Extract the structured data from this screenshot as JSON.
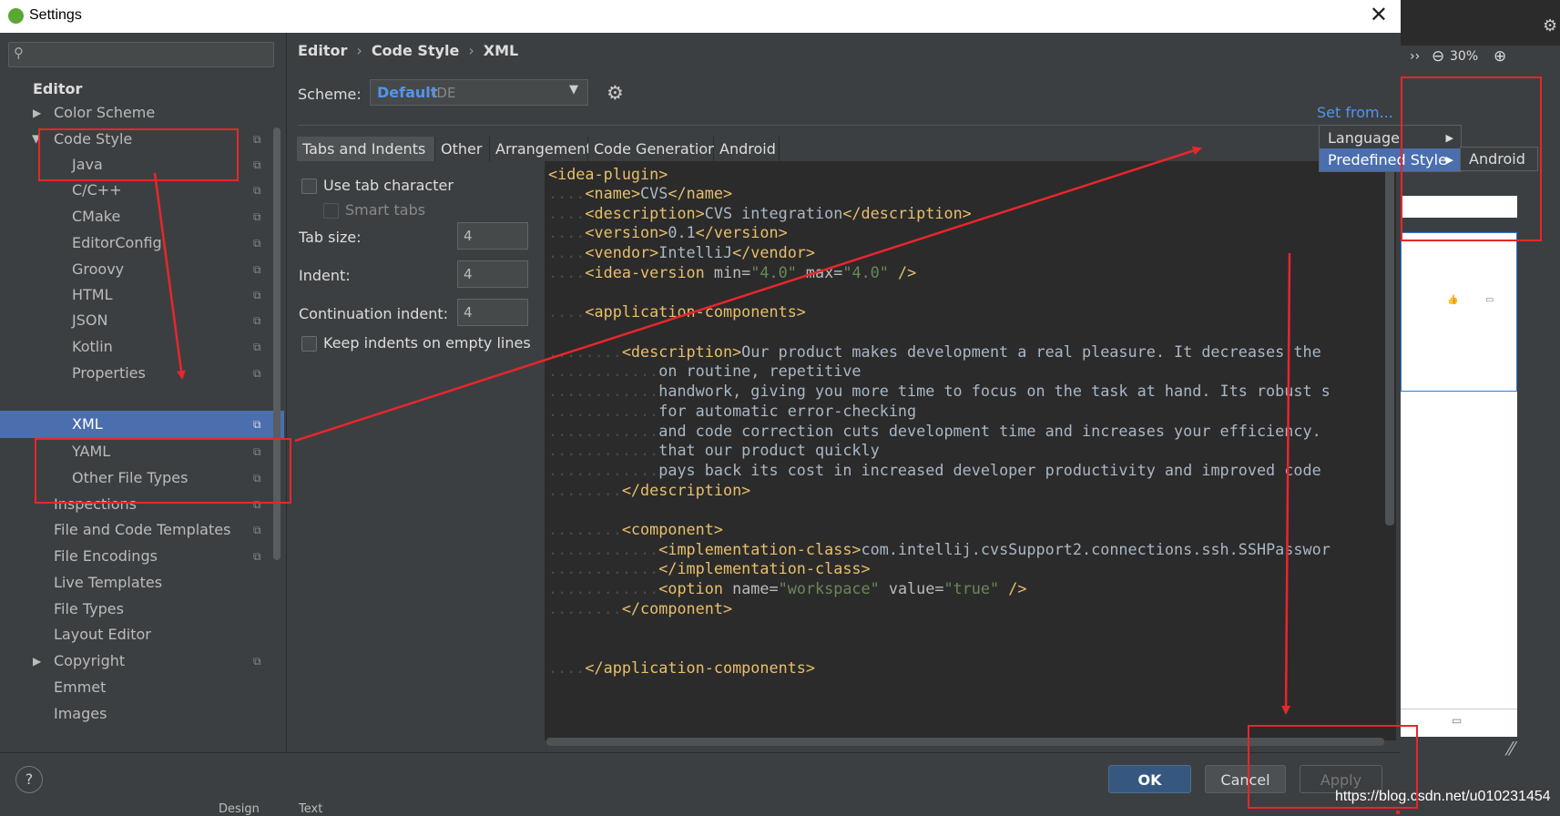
{
  "window": {
    "title": "Settings",
    "close_glyph": "✕"
  },
  "search": {
    "placeholder": ""
  },
  "tree": {
    "section_title": "Editor",
    "items": [
      {
        "label": "Color Scheme",
        "expandable": true
      },
      {
        "label": "Code Style",
        "expanded": true
      },
      {
        "label": "Java"
      },
      {
        "label": "C/C++"
      },
      {
        "label": "CMake"
      },
      {
        "label": "EditorConfig"
      },
      {
        "label": "Groovy"
      },
      {
        "label": "HTML"
      },
      {
        "label": "JSON"
      },
      {
        "label": "Kotlin"
      },
      {
        "label": "Properties"
      },
      {
        "label": "XML",
        "selected": true
      },
      {
        "label": "YAML"
      },
      {
        "label": "Other File Types"
      },
      {
        "label": "Inspections"
      },
      {
        "label": "File and Code Templates"
      },
      {
        "label": "File Encodings"
      },
      {
        "label": "Live Templates"
      },
      {
        "label": "File Types"
      },
      {
        "label": "Layout Editor"
      },
      {
        "label": "Copyright",
        "expandable": true
      },
      {
        "label": "Emmet"
      },
      {
        "label": "Images"
      }
    ]
  },
  "breadcrumb": [
    "Editor",
    "Code Style",
    "XML"
  ],
  "breadcrumb_sep": "›",
  "scheme": {
    "label": "Scheme:",
    "name": "Default",
    "scope": "IDE"
  },
  "set_from": "Set from...",
  "tabs": [
    "Tabs and Indents",
    "Other",
    "Arrangement",
    "Code Generation",
    "Android"
  ],
  "options": {
    "use_tab_character": "Use tab character",
    "smart_tabs": "Smart tabs",
    "tab_size_label": "Tab size:",
    "tab_size": "4",
    "indent_label": "Indent:",
    "indent": "4",
    "continuation_label": "Continuation indent:",
    "continuation": "4",
    "keep_indents": "Keep indents on empty lines"
  },
  "code": {
    "l1_tag": "<idea-plugin>",
    "l2_open": "<name>",
    "l2_text": "CVS",
    "l2_close": "</name>",
    "l3_open": "<description>",
    "l3_text": "CVS integration",
    "l3_close": "</description>",
    "l4_open": "<version>",
    "l4_text": "0.1",
    "l4_close": "</version>",
    "l5_open": "<vendor>",
    "l5_text": "IntelliJ",
    "l5_close": "</vendor>",
    "l6_open": "<idea-version",
    "l6_attr1": " min=",
    "l6_val1": "\"4.0\"",
    "l6_attr2": " max=",
    "l6_val2": "\"4.0\"",
    "l6_close": " />",
    "l8_tag": "<application-components>",
    "l10_open": "<description>",
    "l10_text": "Our product makes development a real pleasure. It decreases the",
    "l11_text": "on routine, repetitive",
    "l12_text": "handwork, giving you more time to focus on the task at hand. Its robust s",
    "l13_text": "for automatic error-checking",
    "l14_text": "and code correction cuts development time and increases your efficiency.",
    "l15_text": "that our product quickly",
    "l16_text": "pays back its cost in increased developer productivity and improved code",
    "l17_close": "</description>",
    "l19_tag": "<component>",
    "l20_open": "<implementation-class>",
    "l20_text": "com.intellij.cvsSupport2.connections.ssh.SSHPasswor",
    "l21_close": "</implementation-class>",
    "l22_open": "<option",
    "l22_attr1": " name=",
    "l22_val1": "\"workspace\"",
    "l22_attr2": " value=",
    "l22_val2": "\"true\"",
    "l22_close": " />",
    "l23_close": "</component>",
    "l26_close": "</application-components>"
  },
  "popup": {
    "items": [
      "Language",
      "Predefined Style"
    ],
    "submenu": [
      "Android"
    ],
    "arrow_glyph": "▶"
  },
  "buttons": {
    "help": "?",
    "ok": "OK",
    "cancel": "Cancel",
    "apply": "Apply"
  },
  "background_app": {
    "zoom": "30%",
    "chevron": "››"
  },
  "bottom_strip": {
    "tab_design": "Design",
    "tab_text": "Text"
  },
  "watermark": "https://blog.csdn.net/u010231454",
  "colors": {
    "accent": "#4b6eaf",
    "link": "#5394ec",
    "annotation": "#e8262c",
    "tag": "#e8bf6a",
    "string": "#6a8759"
  }
}
